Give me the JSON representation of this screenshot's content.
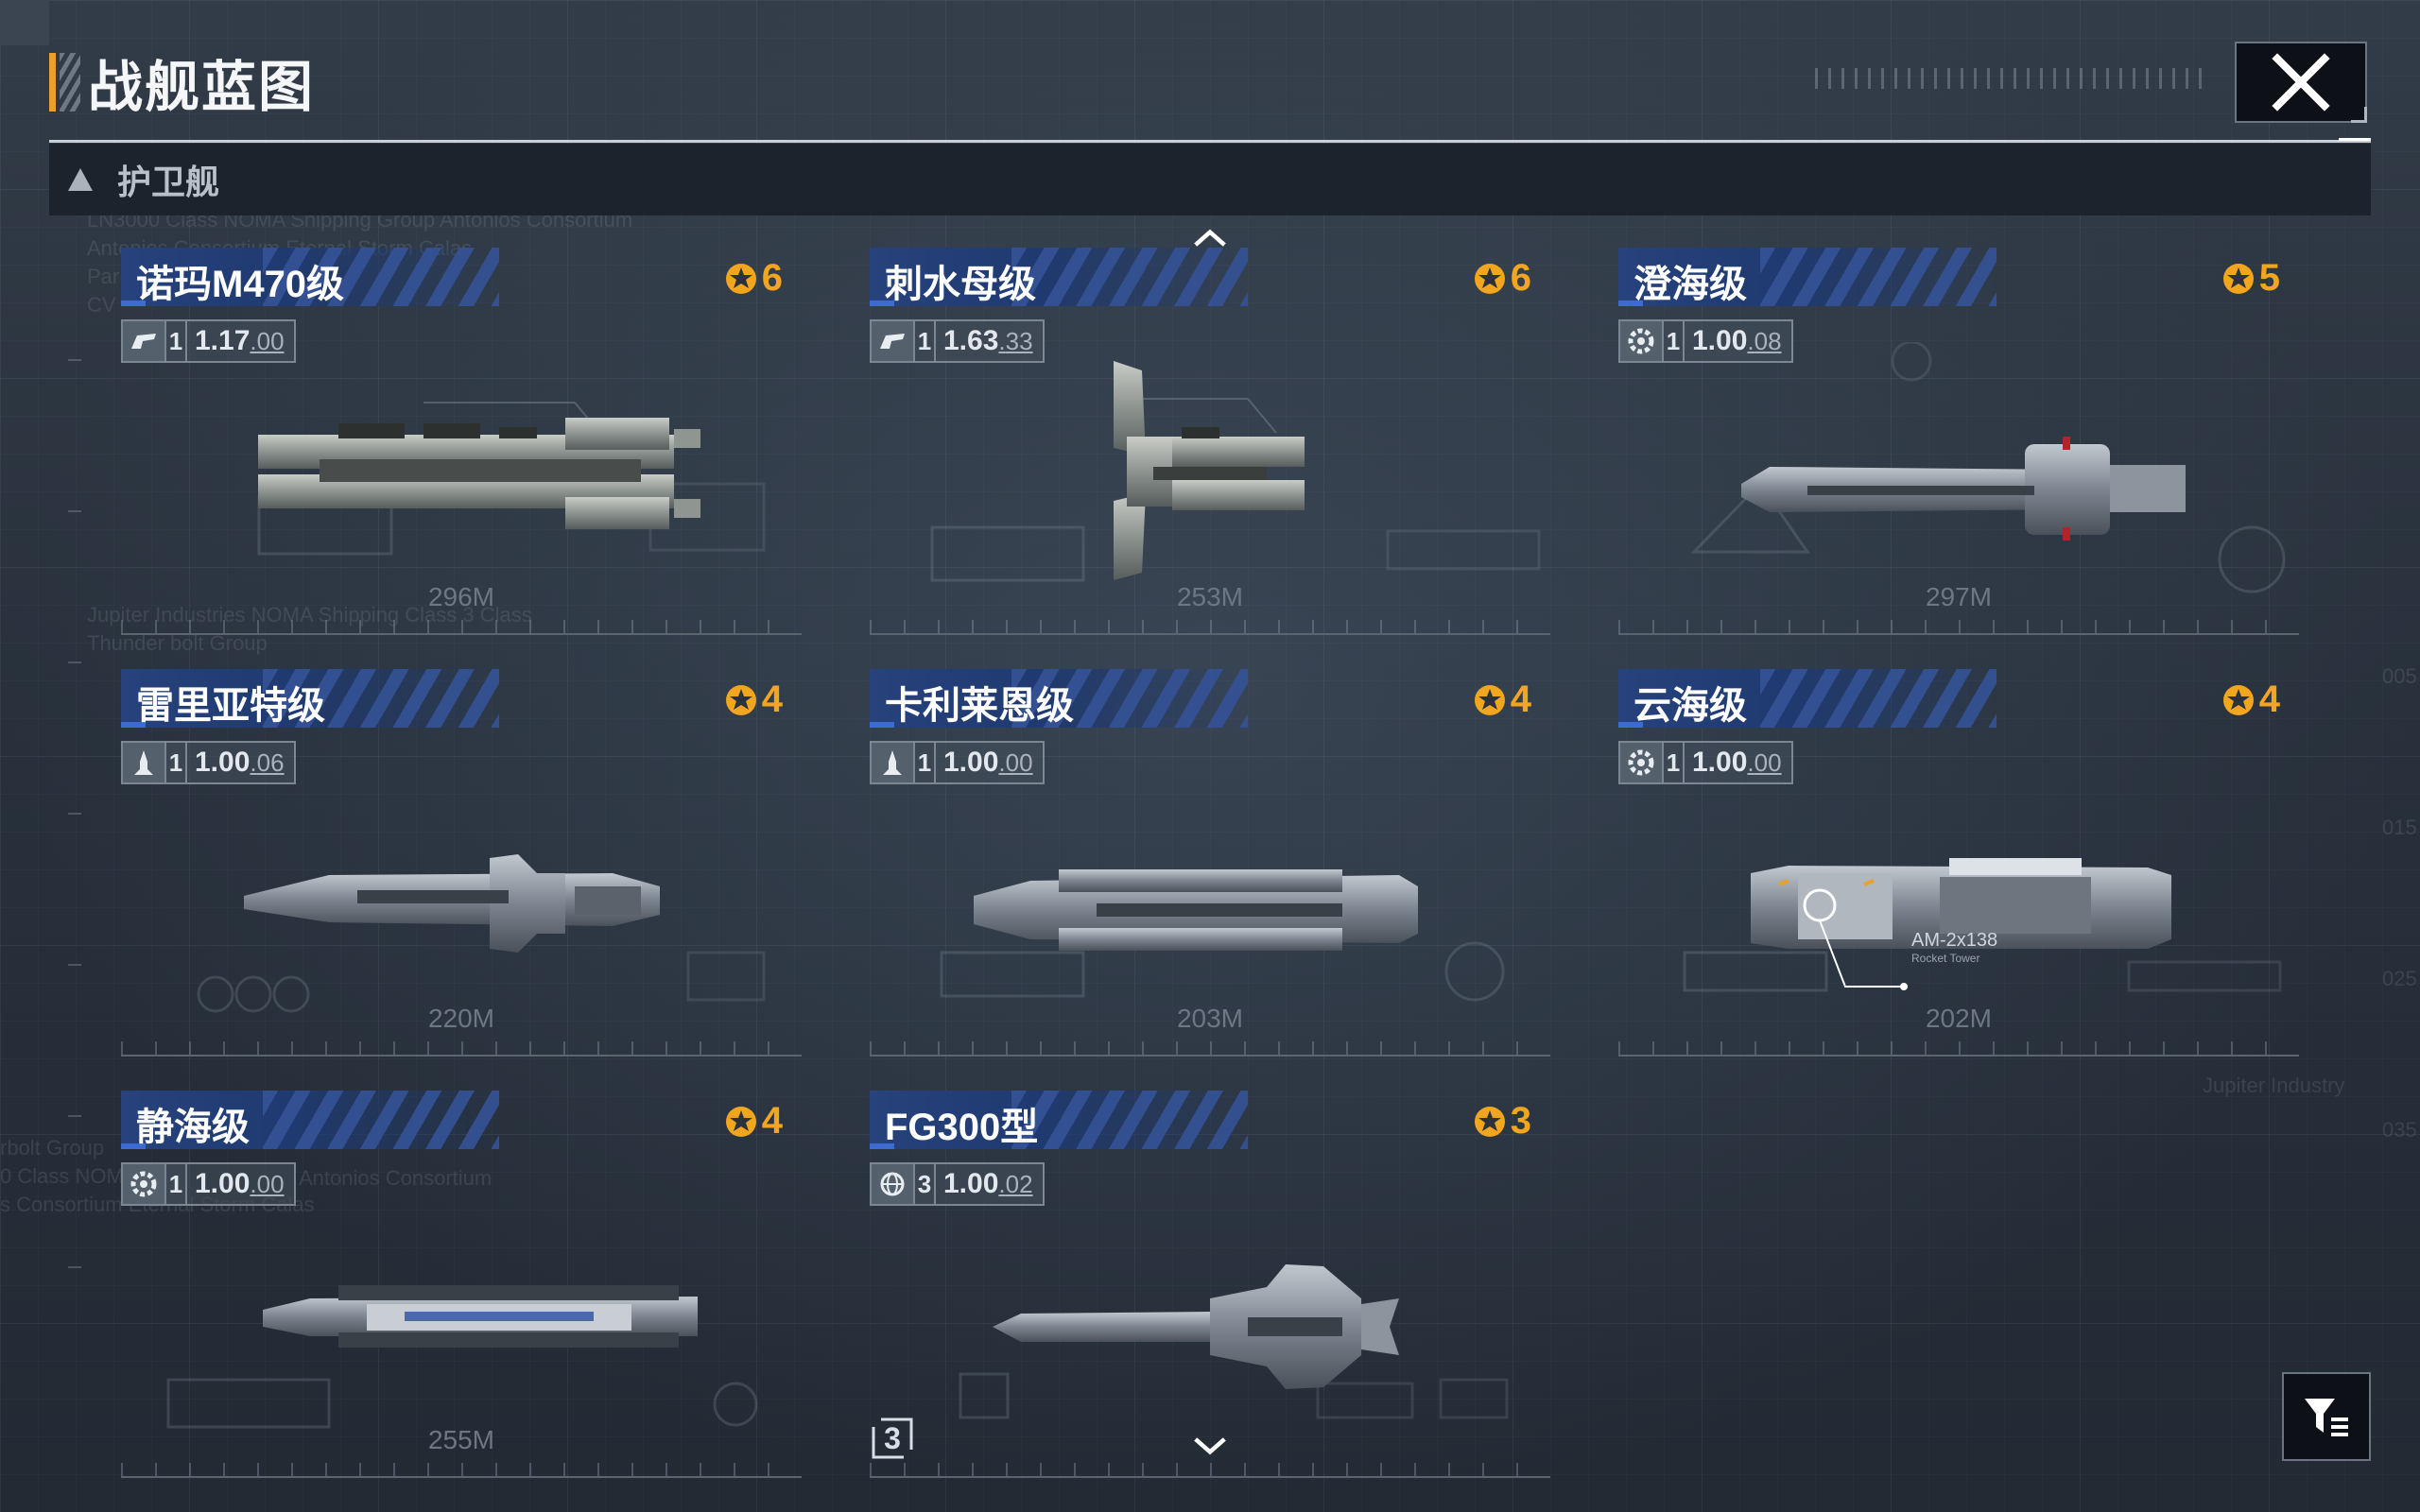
{
  "header": {
    "title": "战舰蓝图"
  },
  "category": {
    "label": "护卫舰"
  },
  "pagination": {
    "current": "3"
  },
  "colors": {
    "accent_orange": "#f2a51e",
    "title_blue": "#27427c",
    "header_bar": "#e8a12a"
  },
  "background_text": {
    "left_top": [
      "LN3000 Class NOMA Shipping Group Antonios Consortium",
      "Antonios Consortium Eternal Storm Calas",
      "Par",
      "CV"
    ],
    "left_mid": [
      "Jupiter Industries NOMA Shipping Class 3 Class",
      "Thunder bolt Group"
    ],
    "left_bottom": [
      "rbolt Group",
      "0 Class NOM",
      "s Consortium Eternal Storm Calas"
    ],
    "left_bottom_right": "Antonios Consortium",
    "right_bottom": "Jupiter Industry",
    "right_edge": [
      "005",
      "015",
      "025",
      "035"
    ]
  },
  "ships": [
    {
      "name": "诺玛M470级",
      "rating": "6",
      "icon": "hull-icon",
      "level": "1",
      "value": "1.17",
      "sub": "00",
      "length": "296M",
      "annotation": ""
    },
    {
      "name": "刺水母级",
      "rating": "6",
      "icon": "hull-icon",
      "level": "1",
      "value": "1.63",
      "sub": "33",
      "length": "253M",
      "annotation": ""
    },
    {
      "name": "澄海级",
      "rating": "5",
      "icon": "gear-icon",
      "level": "1",
      "value": "1.00",
      "sub": "08",
      "length": "297M",
      "annotation": ""
    },
    {
      "name": "雷里亚特级",
      "rating": "4",
      "icon": "rocket-icon",
      "level": "1",
      "value": "1.00",
      "sub": "06",
      "length": "220M",
      "annotation": ""
    },
    {
      "name": "卡利莱恩级",
      "rating": "4",
      "icon": "rocket-icon",
      "level": "1",
      "value": "1.00",
      "sub": "00",
      "length": "203M",
      "annotation": ""
    },
    {
      "name": "云海级",
      "rating": "4",
      "icon": "gear-icon",
      "level": "1",
      "value": "1.00",
      "sub": "00",
      "length": "202M",
      "annotation": "AM-2x138",
      "annotation_sub": "Rocket Tower"
    },
    {
      "name": "静海级",
      "rating": "4",
      "icon": "gear-icon",
      "level": "1",
      "value": "1.00",
      "sub": "00",
      "length": "255M",
      "annotation": ""
    },
    {
      "name": "FG300型",
      "rating": "3",
      "icon": "globe-icon",
      "level": "3",
      "value": "1.00",
      "sub": "02",
      "length": "",
      "annotation": ""
    }
  ]
}
